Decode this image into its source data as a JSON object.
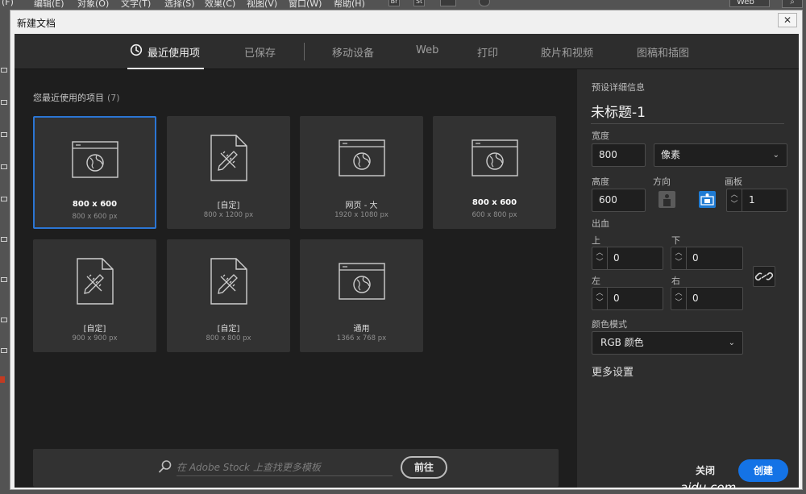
{
  "menubar": {
    "items": [
      "(F)",
      "编辑(E)",
      "对象(O)",
      "文字(T)",
      "选择(S)",
      "效果(C)",
      "视图(V)",
      "窗口(W)",
      "帮助(H)"
    ],
    "br": "Br",
    "st": "St",
    "workspace": "Web"
  },
  "dialog": {
    "title": "新建文档",
    "close_glyph": "✕"
  },
  "tabs": [
    "最近使用项",
    "已保存",
    "移动设备",
    "Web",
    "打印",
    "胶片和视频",
    "图稿和插图"
  ],
  "recent": {
    "title": "您最近使用的项目",
    "count": "(7)",
    "items": [
      {
        "name": "800 x 600",
        "size": "800 x 600 px",
        "icon": "web-page-icon"
      },
      {
        "name": "[自定]",
        "size": "800 x 1200 px",
        "icon": "custom-document-icon"
      },
      {
        "name": "网页 - 大",
        "size": "1920 x 1080 px",
        "icon": "web-page-icon"
      },
      {
        "name": "800 x 600",
        "size": "600 x 800 px",
        "icon": "web-page-icon"
      },
      {
        "name": "[自定]",
        "size": "900 x 900 px",
        "icon": "custom-document-icon"
      },
      {
        "name": "[自定]",
        "size": "800 x 800 px",
        "icon": "custom-document-icon"
      },
      {
        "name": "通用",
        "size": "1366 x 768 px",
        "icon": "web-page-icon"
      }
    ]
  },
  "stock": {
    "placeholder": "在 Adobe Stock 上查找更多模板",
    "go_label": "前往"
  },
  "preset": {
    "header": "预设详细信息",
    "doc_name": "未标题-1",
    "width_label": "宽度",
    "width_value": "800",
    "unit": "像素",
    "height_label": "高度",
    "height_value": "600",
    "orientation_label": "方向",
    "artboards_label": "画板",
    "artboards_value": "1",
    "bleed_label": "出血",
    "top_label": "上",
    "top_value": "0",
    "bottom_label": "下",
    "bottom_value": "0",
    "left_label": "左",
    "left_value": "0",
    "right_label": "右",
    "right_value": "0",
    "color_mode_label": "颜色模式",
    "color_mode_value": "RGB 颜色",
    "more_settings": "更多设置",
    "close_label": "关闭",
    "create_label": "创建",
    "watermark": "aidu.com"
  },
  "colors": {
    "accent": "#1473e6",
    "selection": "#2b75d3",
    "panel": "#2d2d2d",
    "card": "#323232"
  }
}
